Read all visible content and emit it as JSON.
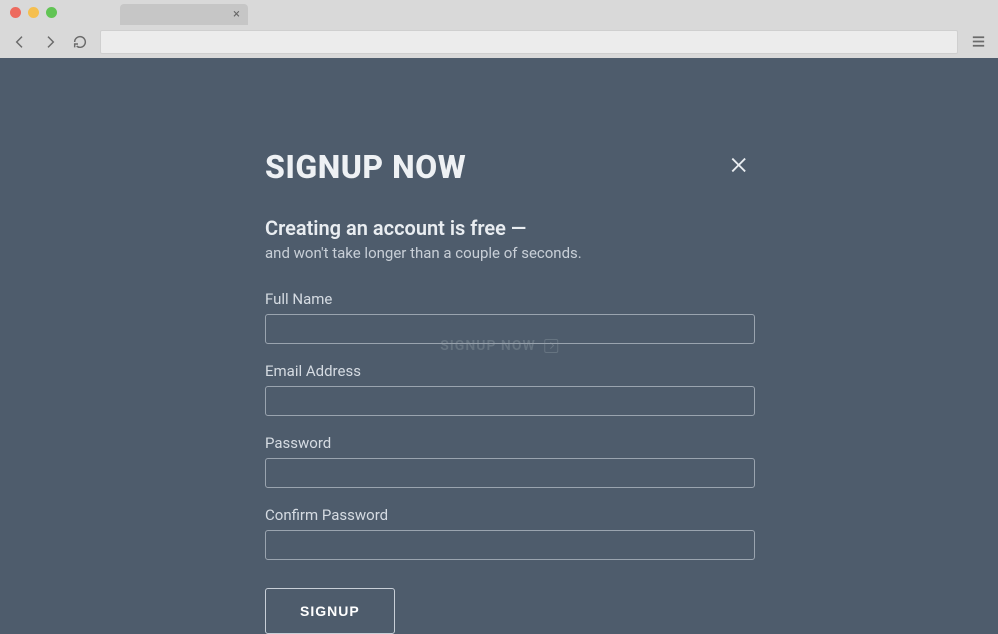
{
  "browser": {
    "url": "",
    "tab_close": "×"
  },
  "ghost": {
    "label": "SIGNUP NOW"
  },
  "modal": {
    "title": "SIGNUP NOW",
    "subhead_strong": "Creating an account is free —",
    "subhead_desc": "and won't take longer than a couple of seconds.",
    "fields": {
      "fullname": {
        "label": "Full Name",
        "value": ""
      },
      "email": {
        "label": "Email Address",
        "value": ""
      },
      "password": {
        "label": "Password",
        "value": ""
      },
      "confirm": {
        "label": "Confirm Password",
        "value": ""
      }
    },
    "submit_label": "SIGNUP"
  }
}
